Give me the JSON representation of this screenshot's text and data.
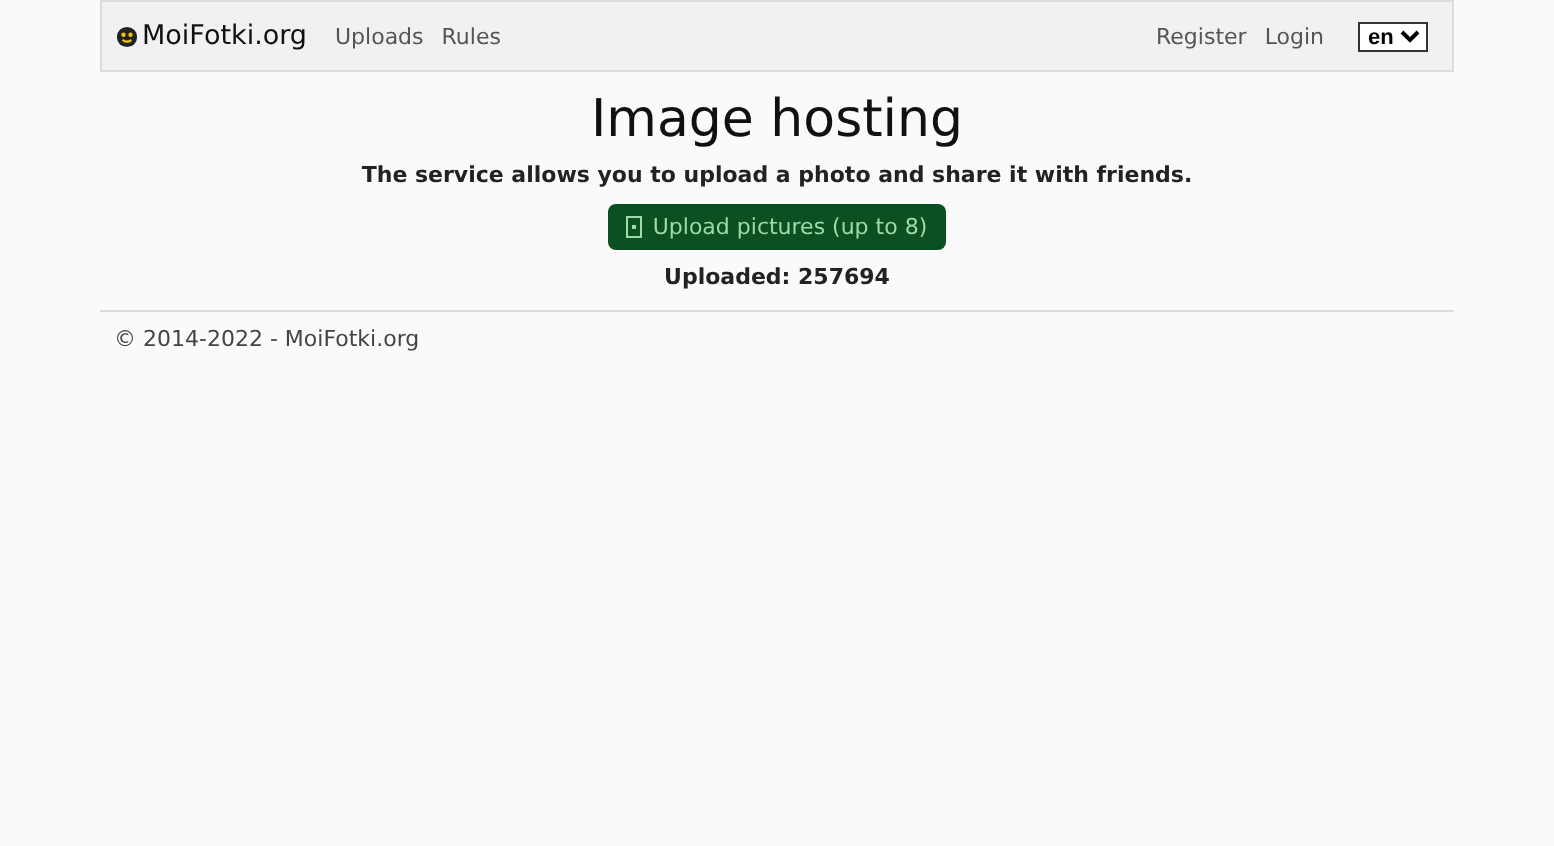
{
  "navbar": {
    "brand": "MoiFotki.org",
    "links": [
      "Uploads",
      "Rules"
    ],
    "right_links": [
      "Register",
      "Login"
    ],
    "language": "en"
  },
  "main": {
    "title": "Image hosting",
    "subtitle": "The service allows you to upload a photo and share it with friends.",
    "upload_button": "Upload pictures (up to 8)",
    "counter": "Uploaded: 257694"
  },
  "footer": {
    "copyright": "© 2014-2022 - MoiFotki.org"
  }
}
